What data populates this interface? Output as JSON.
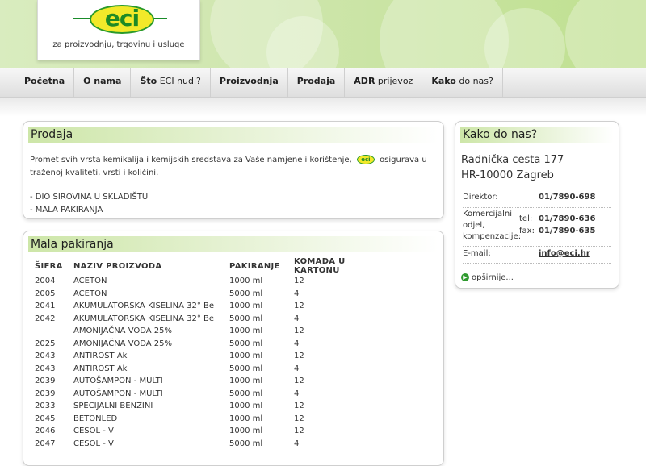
{
  "header": {
    "logo_text": "eci",
    "tagline": "za proizvodnju, trgovinu i usluge"
  },
  "nav": {
    "items": [
      {
        "label": "Početna"
      },
      {
        "label": "O nama"
      },
      {
        "label_bold": "Što",
        "label_light": " ECI nudi?"
      },
      {
        "label": "Proizvodnja"
      },
      {
        "label": "Prodaja"
      },
      {
        "label_bold": "ADR",
        "label_light": " prijevoz"
      },
      {
        "label_bold": "Kako",
        "label_light": " do nas?"
      }
    ]
  },
  "prodaja": {
    "title": "Prodaja",
    "text_before_logo": "Promet svih vrsta kemikalija i kemijskih sredstava za Vaše namjene i korištenje,",
    "logo_text": "eci",
    "text_after_logo": "osigurava u traženoj kvaliteti, vrsti i količini.",
    "list": [
      "- DIO SIROVINA U SKLADIŠTU",
      "- MALA PAKIRANJA"
    ]
  },
  "mala": {
    "title": "Mala pakiranja",
    "headers": [
      "ŠIFRA",
      "NAZIV PROIZVODA",
      "PAKIRANJE",
      "KOMADA U KARTONU"
    ],
    "rows": [
      [
        "2004",
        "ACETON",
        "1000 ml",
        "12"
      ],
      [
        "2005",
        "ACETON",
        "5000 ml",
        "4"
      ],
      [
        "2041",
        "AKUMULATORSKA KISELINA 32° Be",
        "1000 ml",
        "12"
      ],
      [
        "2042",
        "AKUMULATORSKA KISELINA 32° Be",
        "5000 ml",
        "4"
      ],
      [
        "",
        "AMONIJAČNA VODA 25%",
        "1000 ml",
        "12"
      ],
      [
        "2025",
        "AMONIJAČNA VODA 25%",
        "5000 ml",
        "4"
      ],
      [
        "2043",
        "ANTIROST Ak",
        "1000 ml",
        "12"
      ],
      [
        "2043",
        "ANTIROST Ak",
        "5000 ml",
        "4"
      ],
      [
        "2039",
        "AUTOŠAMPON - MULTI",
        "1000 ml",
        "12"
      ],
      [
        "2039",
        "AUTOŠAMPON - MULTI",
        "5000 ml",
        "4"
      ],
      [
        "2033",
        "SPECIJALNI BENZINI",
        "1000 ml",
        "12"
      ],
      [
        "2045",
        "BETONLED",
        "1000 ml",
        "12"
      ],
      [
        "2046",
        "CESOL - V",
        "1000 ml",
        "12"
      ],
      [
        "2047",
        "CESOL - V",
        "5000 ml",
        "4"
      ]
    ]
  },
  "kako": {
    "title": "Kako do nas?",
    "address_line1": "Radnička cesta 177",
    "address_line2": "HR-10000 Zagreb",
    "direktor_label": "Direktor:",
    "direktor_phone": "01/7890-698",
    "komercijalni_label_1": "Komercijalni",
    "komercijalni_label_2": "odjel,",
    "komercijalni_label_3": "kompenzacije:",
    "tel_label": "tel:",
    "tel_value": "01/7890-636",
    "fax_label": "fax:",
    "fax_value": "01/7890-635",
    "email_label": "E-mail:",
    "email_value": "info@eci.hr",
    "more_link": "opširnije..."
  }
}
